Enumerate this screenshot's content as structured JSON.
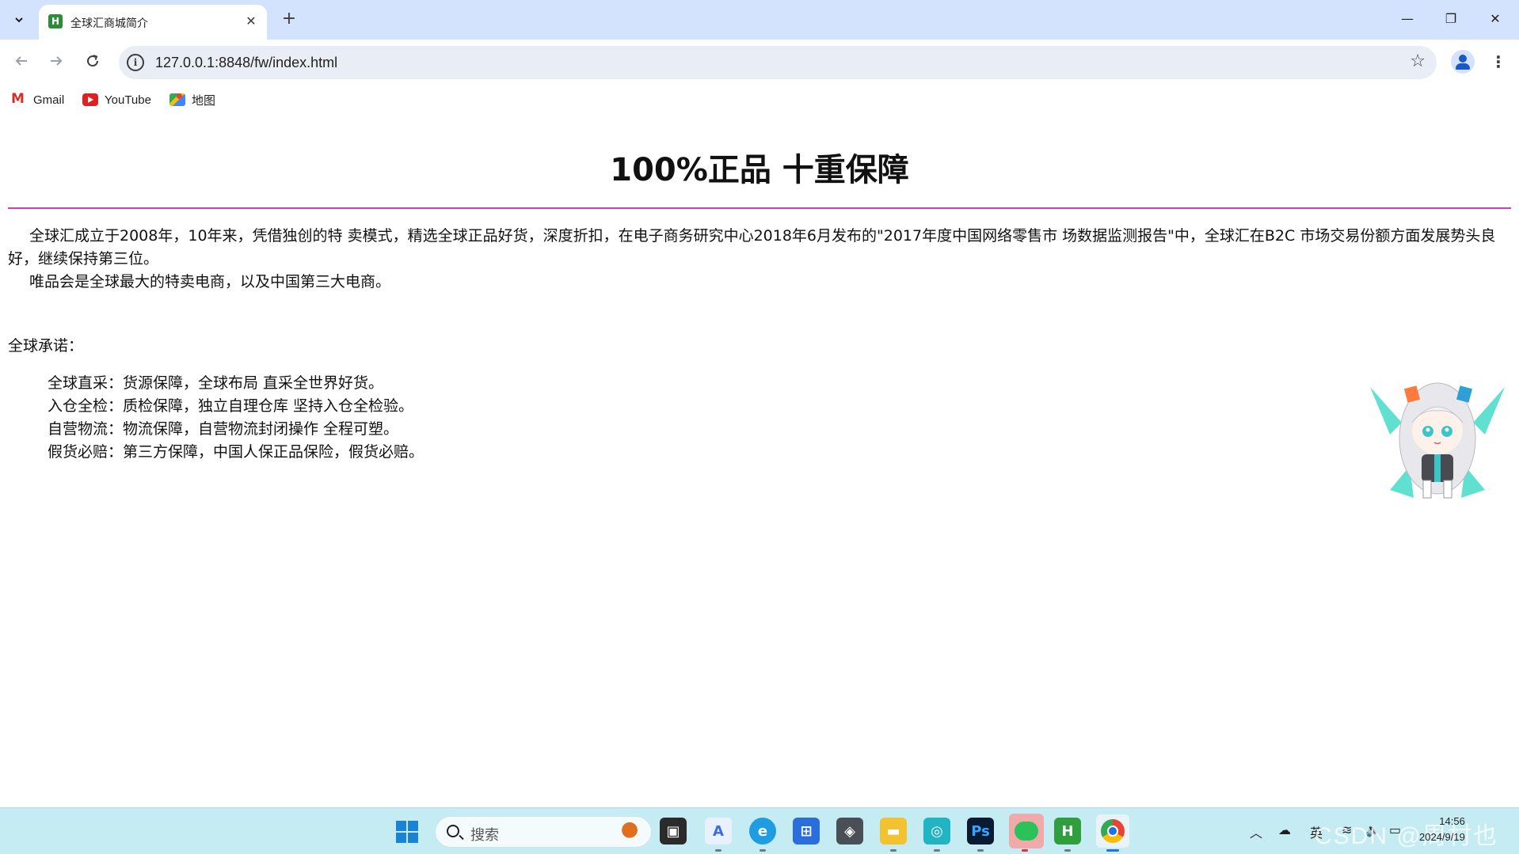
{
  "browser": {
    "tab": {
      "title": "全球汇商城简介",
      "favicon_letter": "H"
    },
    "url": "127.0.0.1:8848/fw/index.html",
    "bookmarks": [
      {
        "label": "Gmail",
        "icon": "gmail-icon"
      },
      {
        "label": "YouTube",
        "icon": "youtube-icon"
      },
      {
        "label": "地图",
        "icon": "maps-icon"
      }
    ]
  },
  "page": {
    "title": "100%正品 十重保障",
    "intro": [
      "全球汇成立于2008年，10年来，凭借独创的特 卖模式，精选全球正品好货，深度折扣，在电子商务研究中心2018年6月发布的\"2017年度中国网络零售市 场数据监测报告\"中，全球汇在B2C 市场交易份额方面发展势头良好，继续保持第三位。",
      "唯品会是全球最大的特卖电商，以及中国第三大电商。"
    ],
    "promise_title": "全球承诺：",
    "promises": [
      "全球直采：货源保障，全球布局 直采全世界好货。",
      "入仓全检：质检保障，独立自理仓库 坚持入仓全检验。",
      "自营物流：物流保障，自营物流封闭操作 全程可塑。",
      "假货必赔：第三方保障，中国人保正品保险，假货必赔。"
    ]
  },
  "taskbar": {
    "search_placeholder": "搜索",
    "ime": "英",
    "time": "14:56",
    "date": "2024/9/19",
    "watermark": "CSDN @周村也"
  },
  "colors": {
    "tabbar_bg": "#d3e3fd",
    "rule": "#d33fb3",
    "taskbar_bg": "#c6ecf3"
  }
}
